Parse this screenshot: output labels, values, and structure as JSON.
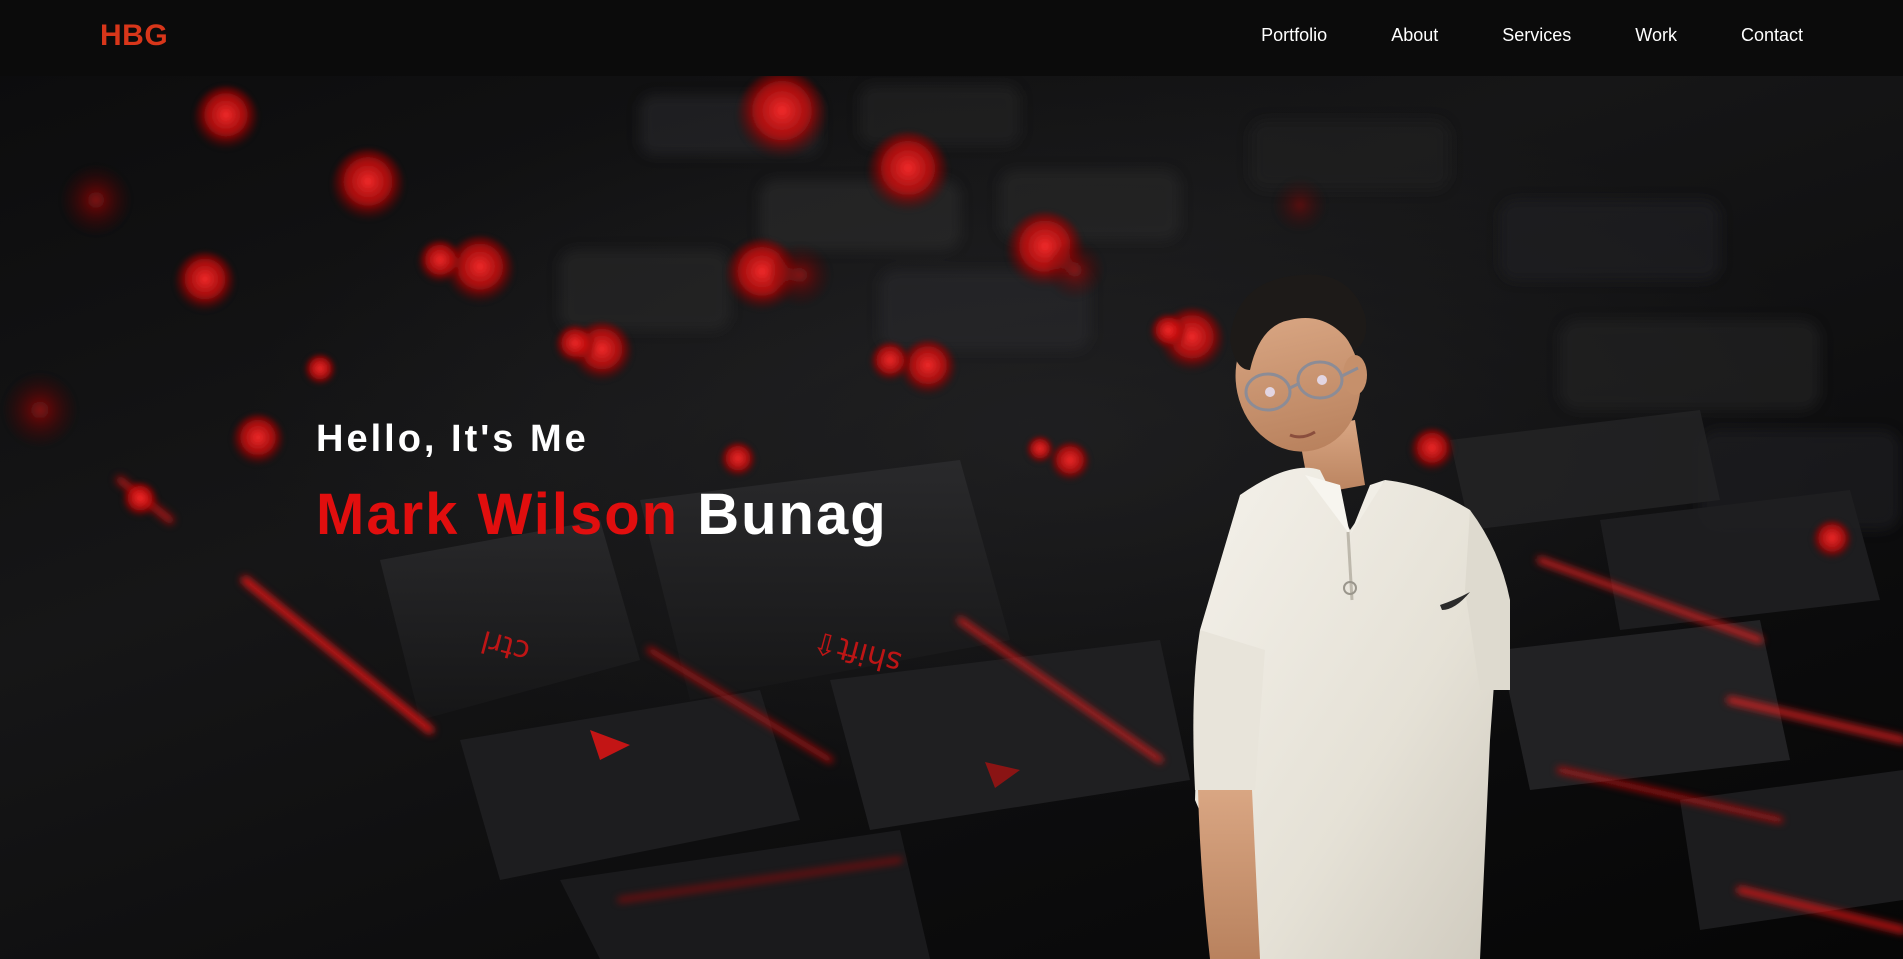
{
  "header": {
    "logo": "HBG",
    "nav": [
      {
        "label": "Portfolio"
      },
      {
        "label": "About"
      },
      {
        "label": "Services"
      },
      {
        "label": "Work"
      },
      {
        "label": "Contact"
      }
    ]
  },
  "hero": {
    "greeting": "Hello, It's Me",
    "name_accent": "Mark Wilson",
    "name_rest": "Bunag"
  },
  "background": {
    "subject": "keyboard-with-red-backlight",
    "key_labels": [
      "ctrl",
      "shift"
    ]
  },
  "colors": {
    "accent": "#e10e0e",
    "logo": "#d8361a",
    "nav_bg": "#0b0b0b",
    "text": "#ffffff"
  }
}
